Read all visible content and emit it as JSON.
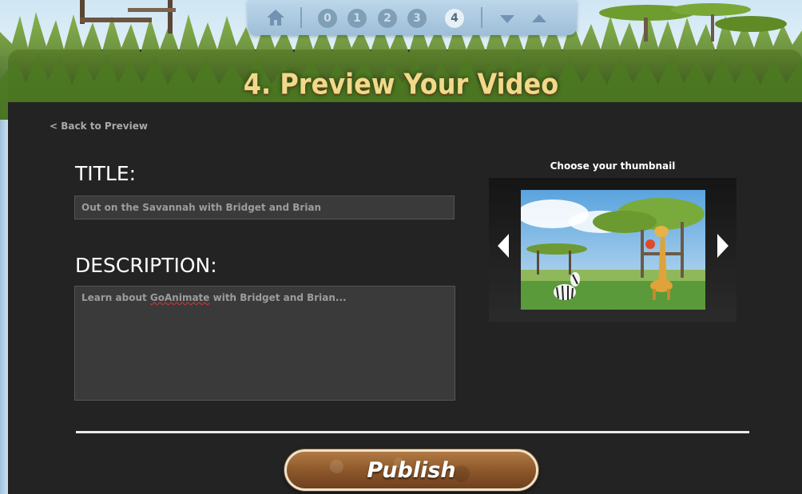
{
  "header": {
    "title": "4. Preview Your Video",
    "steps": [
      "0",
      "1",
      "2",
      "3",
      "4"
    ],
    "active_step": "4",
    "icons": [
      "home-icon",
      "arrow-down-icon",
      "arrow-up-icon"
    ]
  },
  "nav": {
    "back_label": "< Back to Preview"
  },
  "form": {
    "title_label": "TITLE:",
    "title_value": "Out on the Savannah with Bridget and Brian",
    "description_label": "DESCRIPTION:",
    "description_value_prefix": "Learn about ",
    "description_misspelled_word": "GoAnimate",
    "description_value_suffix": " with Bridget and Brian..."
  },
  "thumbnail": {
    "heading": "Choose your thumbnail",
    "icons": [
      "arrow-left-icon",
      "arrow-right-icon"
    ]
  },
  "actions": {
    "publish_label": "Publish"
  },
  "colors": {
    "panel_background": "#232323",
    "title_color": "#f2d98a",
    "nav_bar": "#a9c7de",
    "publish_button": "#8a5528"
  }
}
